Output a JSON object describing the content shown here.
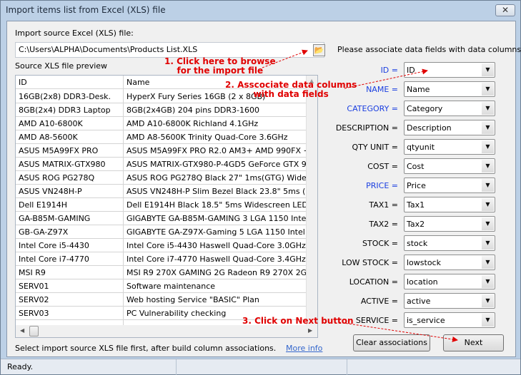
{
  "window": {
    "title": "Import items list from Excel (XLS) file",
    "close_icon": "close-icon"
  },
  "source": {
    "label": "Import source Excel (XLS) file:",
    "path": "C:\\Users\\ALPHA\\Documents\\Products List.XLS",
    "browse_icon": "folder-open-icon"
  },
  "preview": {
    "label": "Source XLS file preview",
    "headers": [
      "ID",
      "Name"
    ],
    "rows": [
      [
        "16GB(2x8) DDR3-Desk.",
        "HyperX Fury Series 16GB (2 x 8GB)"
      ],
      [
        "8GB(2x4) DDR3 Laptop",
        "8GB(2x4GB) 204 pins DDR3-1600"
      ],
      [
        "AMD A10-6800K",
        "AMD A10-6800K Richland 4.1GHz"
      ],
      [
        "AMD A8-5600K",
        "AMD A8-5600K Trinity Quad-Core 3.6GHz"
      ],
      [
        "ASUS M5A99FX PRO",
        "ASUS M5A99FX PRO R2.0 AM3+ AMD 990FX + SB95"
      ],
      [
        "ASUS MATRIX-GTX980",
        "ASUS MATRIX-GTX980-P-4GD5 GeForce GTX 980 4GI"
      ],
      [
        "ASUS ROG PG278Q",
        "ASUS ROG PG278Q Black 27\" 1ms(GTG) Widescreen"
      ],
      [
        "ASUS VN248H-P",
        "ASUS VN248H-P Slim Bezel Black 23.8\" 5ms (GTG) HD"
      ],
      [
        "Dell E1914H",
        "Dell E1914H Black 18.5\" 5ms Widescreen LED Backligl"
      ],
      [
        "GA-B85M-GAMING",
        "GIGABYTE GA-B85M-GAMING 3 LGA 1150 Intel B85 H"
      ],
      [
        "GB-GA-Z97X",
        "GIGABYTE GA-Z97X-Gaming 5 LGA 1150 Intel Z97 HD"
      ],
      [
        "Intel Core i5-4430",
        "Intel Core i5-4430 Haswell Quad-Core 3.0GHz LGA 1"
      ],
      [
        "Intel Core i7-4770",
        "Intel Core i7-4770 Haswell Quad-Core 3.4GHz LGA 1"
      ],
      [
        "MSI R9",
        "MSI R9 270X GAMING 2G Radeon R9 270X 2GB 256-I"
      ],
      [
        "SERV01",
        "Software maintenance"
      ],
      [
        "SERV02",
        "Web hosting Service \"BASIC\" Plan"
      ],
      [
        "SERV03",
        "PC Vulnerability checking"
      ]
    ]
  },
  "fields": {
    "heading": "Please associate data fields with data columns",
    "items": [
      {
        "label": "ID =",
        "value": "ID",
        "required": true
      },
      {
        "label": "NAME =",
        "value": "Name",
        "required": true
      },
      {
        "label": "CATEGORY =",
        "value": "Category",
        "required": true
      },
      {
        "label": "DESCRIPTION =",
        "value": "Description",
        "required": false
      },
      {
        "label": "QTY UNIT =",
        "value": "qtyunit",
        "required": false
      },
      {
        "label": "COST =",
        "value": "Cost",
        "required": false
      },
      {
        "label": "PRICE =",
        "value": "Price",
        "required": true
      },
      {
        "label": "TAX1 =",
        "value": "Tax1",
        "required": false
      },
      {
        "label": "TAX2 =",
        "value": "Tax2",
        "required": false
      },
      {
        "label": "STOCK =",
        "value": "stock",
        "required": false
      },
      {
        "label": "LOW STOCK =",
        "value": "lowstock",
        "required": false
      },
      {
        "label": "LOCATION =",
        "value": "location",
        "required": false
      },
      {
        "label": "ACTIVE =",
        "value": "active",
        "required": false
      },
      {
        "label": "SERVICE =",
        "value": "is_service",
        "required": false
      }
    ]
  },
  "footer": {
    "hint": "Select import source XLS file first, after build column associations.",
    "more_info": "More info",
    "clear_button": "Clear associations",
    "next_button": "Next"
  },
  "annotations": {
    "a1_line1": "1. Click here to browse",
    "a1_line2": "for the import file",
    "a2_line1": "2. Asscociate data columns",
    "a2_line2": "with data fields",
    "a3": "3. Click on Next button"
  },
  "status": {
    "text": "Ready."
  },
  "colors": {
    "required_label": "#1a3ee0",
    "annotation": "#e00000",
    "link": "#3366cc"
  }
}
